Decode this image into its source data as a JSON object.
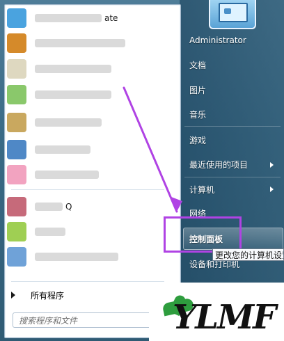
{
  "start_menu": {
    "left": {
      "programs": [
        {
          "label": "ate",
          "icon": "app-icon",
          "color": "#4aa3df"
        },
        {
          "label": "",
          "icon": "folder-icon",
          "color": "#d58a2a"
        },
        {
          "label": "",
          "icon": "app-icon",
          "color": "#ded8c0"
        },
        {
          "label": "",
          "icon": "app-icon",
          "color": "#8ac86b"
        },
        {
          "label": "",
          "icon": "app-icon",
          "color": "#4f88c6"
        },
        {
          "label": "",
          "icon": "app-icon",
          "color": "#9fcf53"
        },
        {
          "label": "",
          "icon": "app-icon",
          "color": "#f2a3c0"
        },
        {
          "label": "Q",
          "icon": "app-icon",
          "color": "#c66a7a"
        },
        {
          "label": "",
          "icon": "app-icon",
          "color": "#2f6fb6"
        },
        {
          "label": "",
          "icon": "app-icon",
          "color": "#d0d0d0"
        },
        {
          "label": "",
          "icon": "app-icon",
          "color": "#6fa2d8"
        }
      ],
      "all_programs": "所有程序",
      "search_placeholder": "搜索程序和文件"
    },
    "right": {
      "user": "Administrator",
      "items": [
        {
          "label": "文档"
        },
        {
          "label": "图片"
        },
        {
          "label": "音乐"
        },
        {
          "label": "游戏"
        },
        {
          "label": "最近使用的项目"
        },
        {
          "label": "计算机"
        },
        {
          "label": "网络"
        },
        {
          "label": "控制面板"
        },
        {
          "label": "设备和打印机"
        }
      ],
      "tooltip": "更改您的计算机设置"
    },
    "logo_text": "YLMF",
    "colors": {
      "highlight": "#b043e4",
      "logo_green": "#2e9d3e"
    }
  }
}
